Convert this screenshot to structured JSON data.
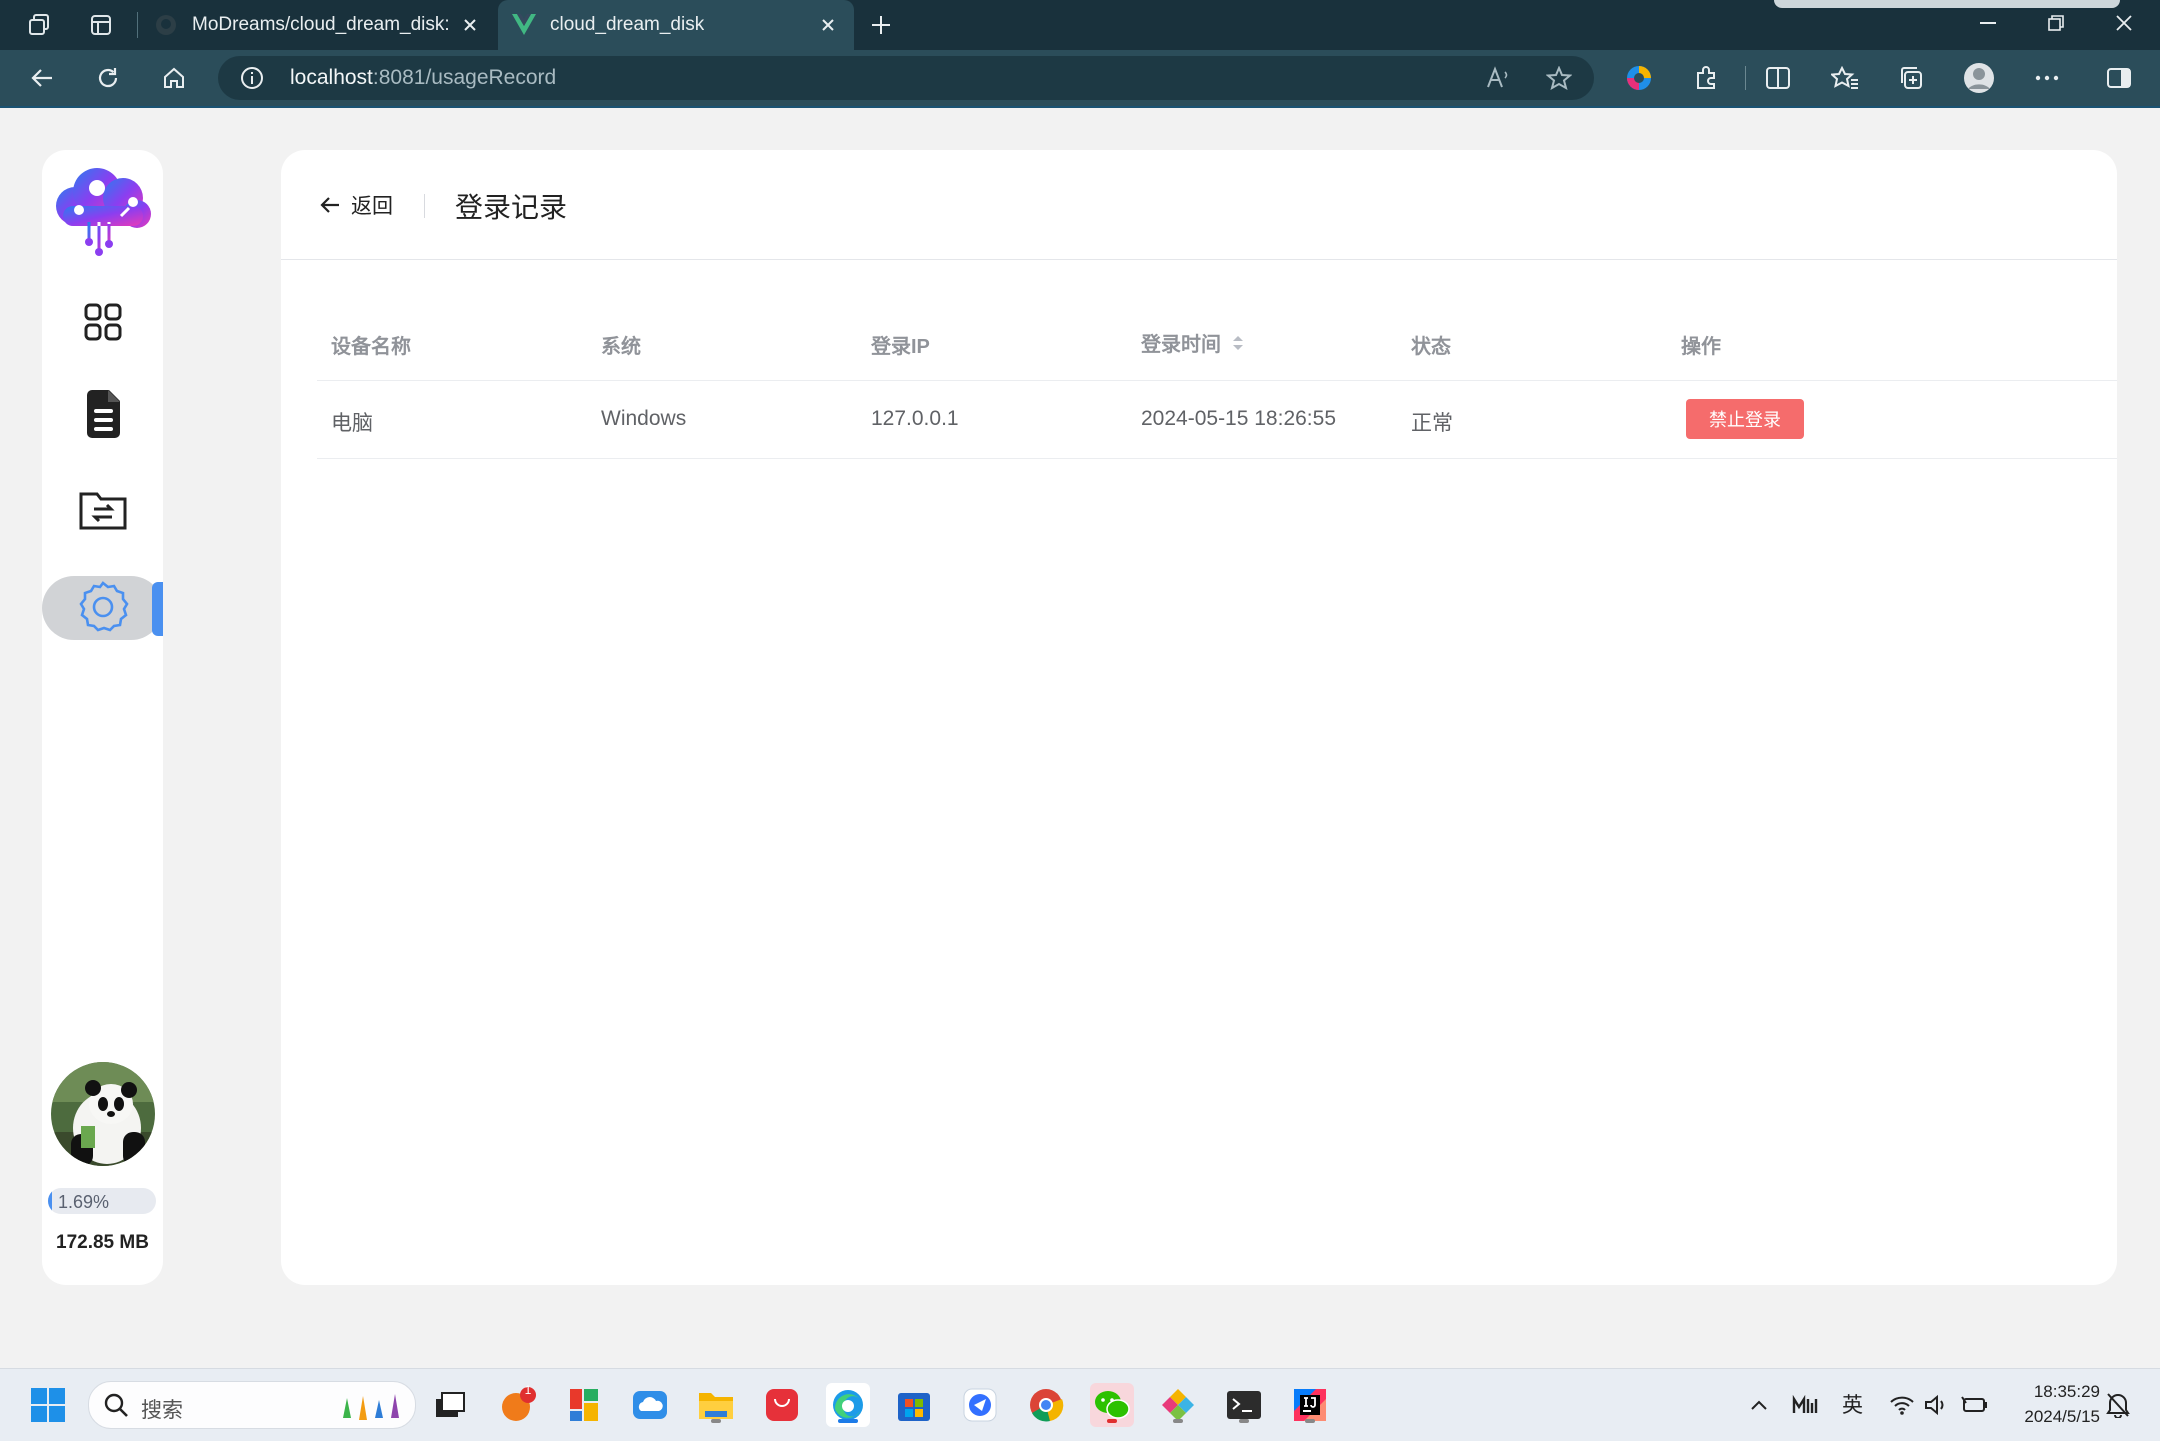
{
  "browser": {
    "tabs": [
      {
        "title": "MoDreams/cloud_dream_disk: "
      },
      {
        "title": "cloud_dream_disk"
      }
    ],
    "url_host": "localhost",
    "url_rest": ":8081/usageRecord"
  },
  "sidebar": {
    "items": [
      "grid-icon",
      "document-icon",
      "folder-transfer-icon",
      "settings-icon"
    ],
    "active_item": "settings",
    "usage_percent_label": "1.69%",
    "usage_fraction": 0.0169,
    "storage_used": "172.85 MB"
  },
  "page": {
    "back_label": "返回",
    "title": "登录记录"
  },
  "table": {
    "headers": [
      "设备名称",
      "系统",
      "登录IP",
      "登录时间",
      "状态",
      "操作"
    ],
    "rows": [
      {
        "device": "电脑",
        "system": "Windows",
        "ip": "127.0.0.1",
        "time": "2024-05-15 18:26:55",
        "status": "正常",
        "action": "禁止登录"
      }
    ]
  },
  "taskbar": {
    "search_placeholder": "搜索",
    "badge_count": "1",
    "ime": "英",
    "time": "18:35:29",
    "date": "2024/5/15"
  },
  "colors": {
    "accent": "#4a90f0",
    "danger": "#f56c6c",
    "titlebar": "#19313c",
    "toolbar": "#2b4d5a"
  }
}
